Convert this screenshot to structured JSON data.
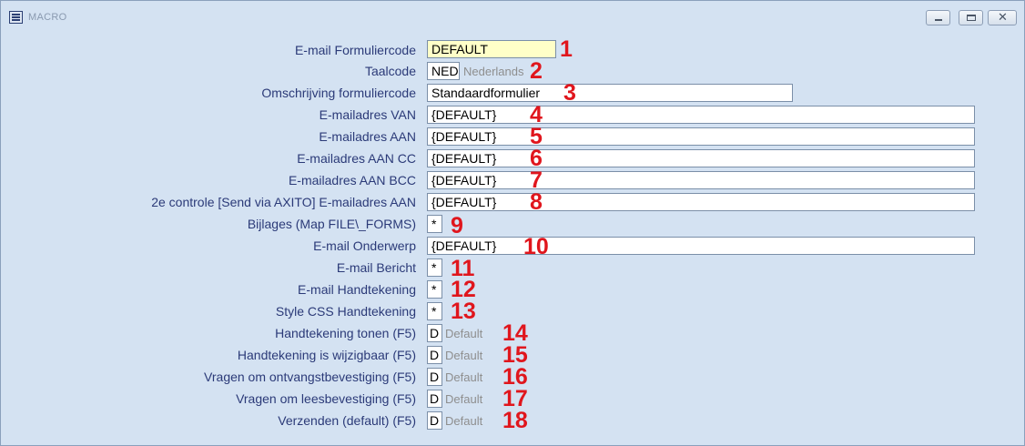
{
  "window": {
    "title": "MACRO",
    "minimize_symbol": "",
    "close_symbol": "✕"
  },
  "rows": [
    {
      "label": "E-mail Formuliercode",
      "value": "DEFAULT",
      "num": "1"
    },
    {
      "label": "Taalcode",
      "value": "NED",
      "hint": "Nederlands",
      "num": "2"
    },
    {
      "label": "Omschrijving formuliercode",
      "value": "Standaardformulier",
      "num": "3"
    },
    {
      "label": "E-mailadres VAN",
      "value": "{DEFAULT}",
      "num": "4"
    },
    {
      "label": "E-mailadres AAN",
      "value": "{DEFAULT}",
      "num": "5"
    },
    {
      "label": "E-mailadres AAN CC",
      "value": "{DEFAULT}",
      "num": "6"
    },
    {
      "label": "E-mailadres AAN BCC",
      "value": "{DEFAULT}",
      "num": "7"
    },
    {
      "label": "2e controle [Send via AXITO] E-mailadres AAN",
      "value": "{DEFAULT}",
      "num": "8"
    },
    {
      "label": "Bijlages (Map FILE\\_FORMS)",
      "value": "*",
      "num": "9"
    },
    {
      "label": "E-mail Onderwerp",
      "value": "{DEFAULT}",
      "num": "10"
    },
    {
      "label": "E-mail Bericht",
      "value": "*",
      "num": "11"
    },
    {
      "label": "E-mail Handtekening",
      "value": "*",
      "num": "12"
    },
    {
      "label": "Style CSS Handtekening",
      "value": "*",
      "num": "13"
    },
    {
      "label": "Handtekening tonen  (F5)",
      "value": "D",
      "hint": "Default",
      "num": "14"
    },
    {
      "label": "Handtekening is wijzigbaar  (F5)",
      "value": "D",
      "hint": "Default",
      "num": "15"
    },
    {
      "label": "Vragen om ontvangstbevestiging  (F5)",
      "value": "D",
      "hint": "Default",
      "num": "16"
    },
    {
      "label": "Vragen om leesbevestiging  (F5)",
      "value": "D",
      "hint": "Default",
      "num": "17"
    },
    {
      "label": "Verzenden (default)  (F5)",
      "value": "D",
      "hint": "Default",
      "num": "18"
    }
  ]
}
